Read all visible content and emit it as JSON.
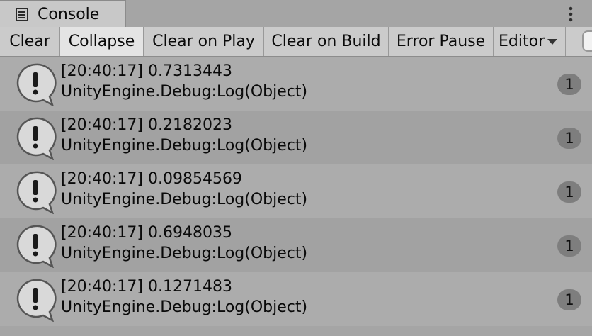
{
  "tab": {
    "title": "Console",
    "icon": "console-icon"
  },
  "window_menu_icon": "kebab-menu-icon",
  "toolbar": {
    "clear": "Clear",
    "collapse": "Collapse",
    "clear_on_play": "Clear on Play",
    "clear_on_build": "Clear on Build",
    "error_pause": "Error Pause",
    "editor": "Editor"
  },
  "log_icon": "info-speech-bubble-icon",
  "colors": {
    "background": "#a5a5a5",
    "toolbar": "#cbcbcb",
    "toggle_on": "#e4e4e4",
    "badge": "#7e7e7e"
  },
  "logs": [
    {
      "message": "[20:40:17] 0.7313443",
      "stack": "UnityEngine.Debug:Log(Object)",
      "count": "1"
    },
    {
      "message": "[20:40:17] 0.2182023",
      "stack": "UnityEngine.Debug:Log(Object)",
      "count": "1"
    },
    {
      "message": "[20:40:17] 0.09854569",
      "stack": "UnityEngine.Debug:Log(Object)",
      "count": "1"
    },
    {
      "message": "[20:40:17] 0.6948035",
      "stack": "UnityEngine.Debug:Log(Object)",
      "count": "1"
    },
    {
      "message": "[20:40:17] 0.1271483",
      "stack": "UnityEngine.Debug:Log(Object)",
      "count": "1"
    }
  ]
}
